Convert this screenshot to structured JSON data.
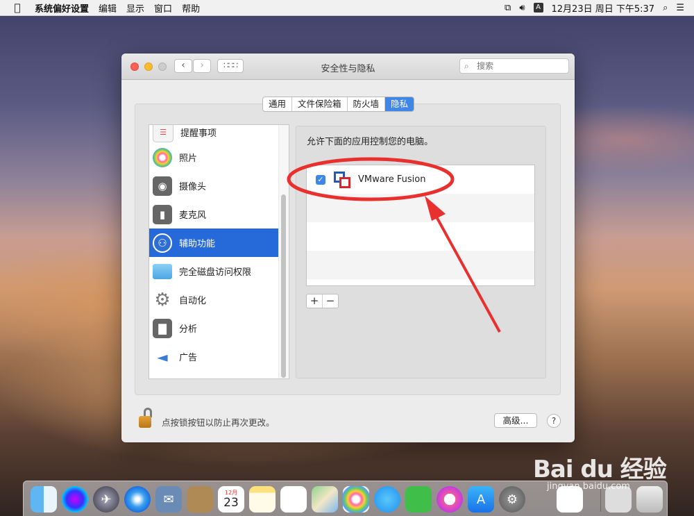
{
  "menubar": {
    "app_name": "系统偏好设置",
    "menus": [
      "编辑",
      "显示",
      "窗口",
      "帮助"
    ],
    "input_method": "A",
    "datetime": "12月23日 周日 下午5:37"
  },
  "window": {
    "title": "安全性与隐私",
    "search_placeholder": "搜索",
    "tabs": [
      {
        "label": "通用",
        "active": false
      },
      {
        "label": "文件保险箱",
        "active": false
      },
      {
        "label": "防火墙",
        "active": false
      },
      {
        "label": "隐私",
        "active": true
      }
    ],
    "categories": [
      {
        "label": "提醒事项",
        "icon": "reminders-icon"
      },
      {
        "label": "照片",
        "icon": "photos-icon"
      },
      {
        "label": "摄像头",
        "icon": "camera-icon"
      },
      {
        "label": "麦克风",
        "icon": "microphone-icon"
      },
      {
        "label": "辅助功能",
        "icon": "accessibility-icon",
        "selected": true
      },
      {
        "label": "完全磁盘访问权限",
        "icon": "folder-icon"
      },
      {
        "label": "自动化",
        "icon": "gear-icon"
      },
      {
        "label": "分析",
        "icon": "analytics-icon"
      },
      {
        "label": "广告",
        "icon": "megaphone-icon"
      }
    ],
    "description": "允许下面的应用控制您的电脑。",
    "apps": [
      {
        "name": "VMware Fusion",
        "checked": true,
        "icon": "vmware-fusion-icon"
      }
    ],
    "add_label": "+",
    "remove_label": "−",
    "lock_text": "点按锁按钮以防止再次更改。",
    "advanced_label": "高级...",
    "help_label": "?"
  },
  "dock": {
    "calendar_day": "23",
    "calendar_month": "12月"
  },
  "watermark": {
    "brand": "Bai du 经验",
    "url": "jingyan.baidu.com"
  },
  "colors": {
    "accent": "#3f86e9",
    "selection": "#2669d8",
    "annotation": "#e8312f"
  }
}
